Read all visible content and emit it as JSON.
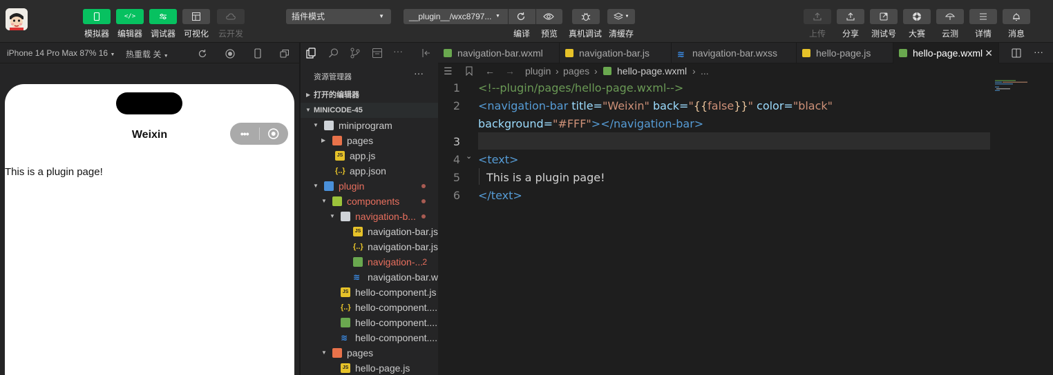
{
  "toolbar": {
    "left_buttons": [
      {
        "name": "simulator",
        "label": "模拟器",
        "icon": "phone-icon",
        "style": "green"
      },
      {
        "name": "editor",
        "label": "编辑器",
        "icon": "code-icon",
        "style": "green"
      },
      {
        "name": "debugger",
        "label": "调试器",
        "icon": "sliders-icon",
        "style": "green"
      },
      {
        "name": "visual",
        "label": "可视化",
        "icon": "layout-icon",
        "style": "gray"
      },
      {
        "name": "cloud-dev",
        "label": "云开发",
        "icon": "cloud-icon",
        "style": "dim"
      }
    ],
    "mode_select": "插件模式",
    "path_select": "__plugin__/wxc8797...",
    "center_buttons": [
      {
        "name": "compile",
        "label": "编译",
        "icon": "refresh-icon"
      },
      {
        "name": "preview",
        "label": "预览",
        "icon": "eye-icon"
      },
      {
        "name": "device-debug",
        "label": "真机调试",
        "icon": "bug-icon"
      },
      {
        "name": "clear-cache",
        "label": "清缓存",
        "icon": "layers-icon"
      }
    ],
    "right_buttons": [
      {
        "name": "upload",
        "label": "上传",
        "icon": "upload-icon",
        "dim": true
      },
      {
        "name": "share",
        "label": "分享",
        "icon": "share-icon"
      },
      {
        "name": "test-account",
        "label": "测试号",
        "icon": "external-icon"
      },
      {
        "name": "contest",
        "label": "大赛",
        "icon": "aperture-icon"
      },
      {
        "name": "cloud-test",
        "label": "云测",
        "icon": "umbrella-icon"
      },
      {
        "name": "details",
        "label": "详情",
        "icon": "menu-icon"
      },
      {
        "name": "messages",
        "label": "消息",
        "icon": "bell-icon"
      }
    ]
  },
  "simulator": {
    "device": "iPhone 14 Pro Max 87% 16",
    "hot_reload": "热重载 关",
    "page_title": "Weixin",
    "page_text": "This is a plugin page!"
  },
  "explorer": {
    "title": "资源管理器",
    "more": "···",
    "open_editors": "打开的编辑器",
    "project": "MINICODE-45",
    "tree": [
      {
        "name": "miniprogram",
        "depth": 1,
        "kind": "folder",
        "open": true
      },
      {
        "name": "pages",
        "depth": 2,
        "kind": "folder-red",
        "open": false
      },
      {
        "name": "app.js",
        "depth": 2,
        "kind": "js"
      },
      {
        "name": "app.json",
        "depth": 2,
        "kind": "json"
      },
      {
        "name": "plugin",
        "depth": 1,
        "kind": "folder-blue",
        "open": true,
        "modified": true
      },
      {
        "name": "components",
        "depth": 2,
        "kind": "folder-green",
        "open": true,
        "modified": true
      },
      {
        "name": "navigation-b...",
        "depth": 3,
        "kind": "folder",
        "open": true,
        "modified": true
      },
      {
        "name": "navigation-bar.js",
        "depth": 4,
        "kind": "js"
      },
      {
        "name": "navigation-bar.js...",
        "depth": 4,
        "kind": "json"
      },
      {
        "name": "navigation-...",
        "depth": 4,
        "kind": "wxml",
        "modified": true,
        "badge": "2"
      },
      {
        "name": "navigation-bar.w...",
        "depth": 4,
        "kind": "wxss"
      },
      {
        "name": "hello-component.js",
        "depth": 3,
        "kind": "js"
      },
      {
        "name": "hello-component....",
        "depth": 3,
        "kind": "json"
      },
      {
        "name": "hello-component....",
        "depth": 3,
        "kind": "wxml"
      },
      {
        "name": "hello-component....",
        "depth": 3,
        "kind": "wxss"
      },
      {
        "name": "pages",
        "depth": 2,
        "kind": "folder-red",
        "open": true
      },
      {
        "name": "hello-page.js",
        "depth": 3,
        "kind": "js"
      }
    ]
  },
  "tabs": [
    {
      "label": "navigation-bar.wxml",
      "kind": "wxml"
    },
    {
      "label": "navigation-bar.js",
      "kind": "js"
    },
    {
      "label": "navigation-bar.wxss",
      "kind": "wxss"
    },
    {
      "label": "hello-page.js",
      "kind": "js"
    },
    {
      "label": "hello-page.wxml",
      "kind": "wxml",
      "active": true
    }
  ],
  "breadcrumb": {
    "parts": [
      "plugin",
      "pages",
      "hello-page.wxml",
      "..."
    ]
  },
  "code": {
    "line_numbers": [
      "1",
      "2",
      "3",
      "4",
      "5",
      "6"
    ],
    "line1": "<!--plugin/pages/hello-page.wxml-->",
    "line2_tag_open": "<navigation-bar",
    "line2_attr_title": " title=",
    "line2_val_title": "\"Weixin\"",
    "line2_attr_back": " back=",
    "line2_q1": "\"",
    "line2_mustache_open": "{{",
    "line2_false": "false",
    "line2_mustache_close": "}}",
    "line2_q2": "\"",
    "line2_attr_color": " color=",
    "line2_val_color": "\"black\"",
    "line2b_attr_bg": "background=",
    "line2b_val_bg": "\"#FFF\"",
    "line2b_close": "></navigation-bar>",
    "line4": "<text>",
    "line5": "This is a plugin page!",
    "line6": "</text>"
  }
}
